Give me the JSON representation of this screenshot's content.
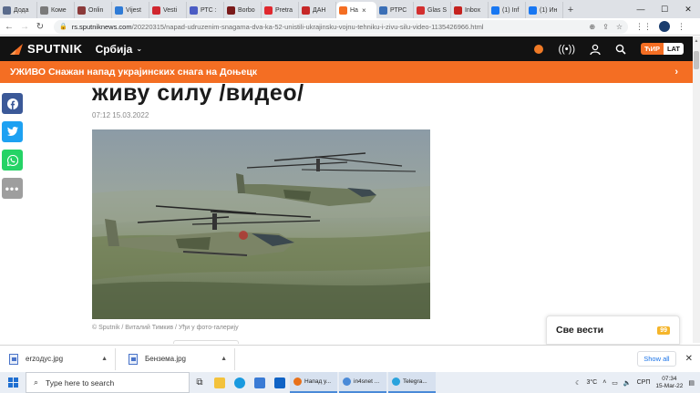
{
  "browser": {
    "tabs": [
      {
        "label": "Дода",
        "color": "#5a6b8c"
      },
      {
        "label": "Коме",
        "color": "#7a7a7a"
      },
      {
        "label": "Onlin",
        "color": "#8b3a3a"
      },
      {
        "label": "Vijest",
        "color": "#2f7bd6"
      },
      {
        "label": "Vesti",
        "color": "#d0262e"
      },
      {
        "label": "РТС :",
        "color": "#4b5cc4"
      },
      {
        "label": "Borbo",
        "color": "#7a1a1a"
      },
      {
        "label": "Pretra",
        "color": "#e0282e"
      },
      {
        "label": "ДАН",
        "color": "#c62828"
      },
      {
        "label": "На",
        "color": "#f46e23",
        "active": true
      },
      {
        "label": "РТРС",
        "color": "#3b6fb6"
      },
      {
        "label": "Glas S",
        "color": "#d32f2f"
      },
      {
        "label": "Inbox",
        "color": "#c5221f"
      },
      {
        "label": "(1) Inf",
        "color": "#1877f2"
      },
      {
        "label": "(1) Ин",
        "color": "#1877f2"
      }
    ],
    "active_tab_close": "×",
    "new_tab": "+",
    "window_controls": {
      "minimize": "—",
      "maximize": "☐",
      "close": "✕"
    },
    "url_host": "rs.sputniknews.com",
    "url_path": "/20220315/napad-udruzenim-snagama-dva-ka-52-unistili-ukrajinsku-vojnu-tehniku-i-zivu-silu-video-1135426966.html"
  },
  "site": {
    "logo_text": "SPUTNIK",
    "region": "Србија",
    "script_cyr": "ЋИР",
    "script_lat": "LAT",
    "live_banner": "УЖИВО Снажан напад украјинских снага на Доњецк"
  },
  "article": {
    "headline_fragment": "живу силу /видео/",
    "date": "07:12 15.03.2022",
    "photo_caption": "© Sputnik / Виталий Тимкив / Уђи у фото-галерију"
  },
  "all_news": {
    "label": "Све вести",
    "count": "99"
  },
  "downloads": {
    "items": [
      "erzoдус.jpg",
      "Бензема.jpg"
    ],
    "show_all": "Show all",
    "close": "✕"
  },
  "taskbar": {
    "search_placeholder": "Type here to search",
    "windows": [
      {
        "label": "Напад у...",
        "color": "#e8711a"
      },
      {
        "label": "in4snet ...",
        "color": "#4a8ad8"
      },
      {
        "label": "Telegra...",
        "color": "#2aa3dd"
      }
    ],
    "weather": "3°C",
    "language": "СРП",
    "time": "07:34",
    "date": "15-Mar-22"
  },
  "colors": {
    "sputnik_orange": "#f46e23",
    "header_black": "#121212",
    "facebook": "#3b5998",
    "twitter": "#1da1f2",
    "whatsapp": "#25d366",
    "more": "#9e9e9e"
  }
}
